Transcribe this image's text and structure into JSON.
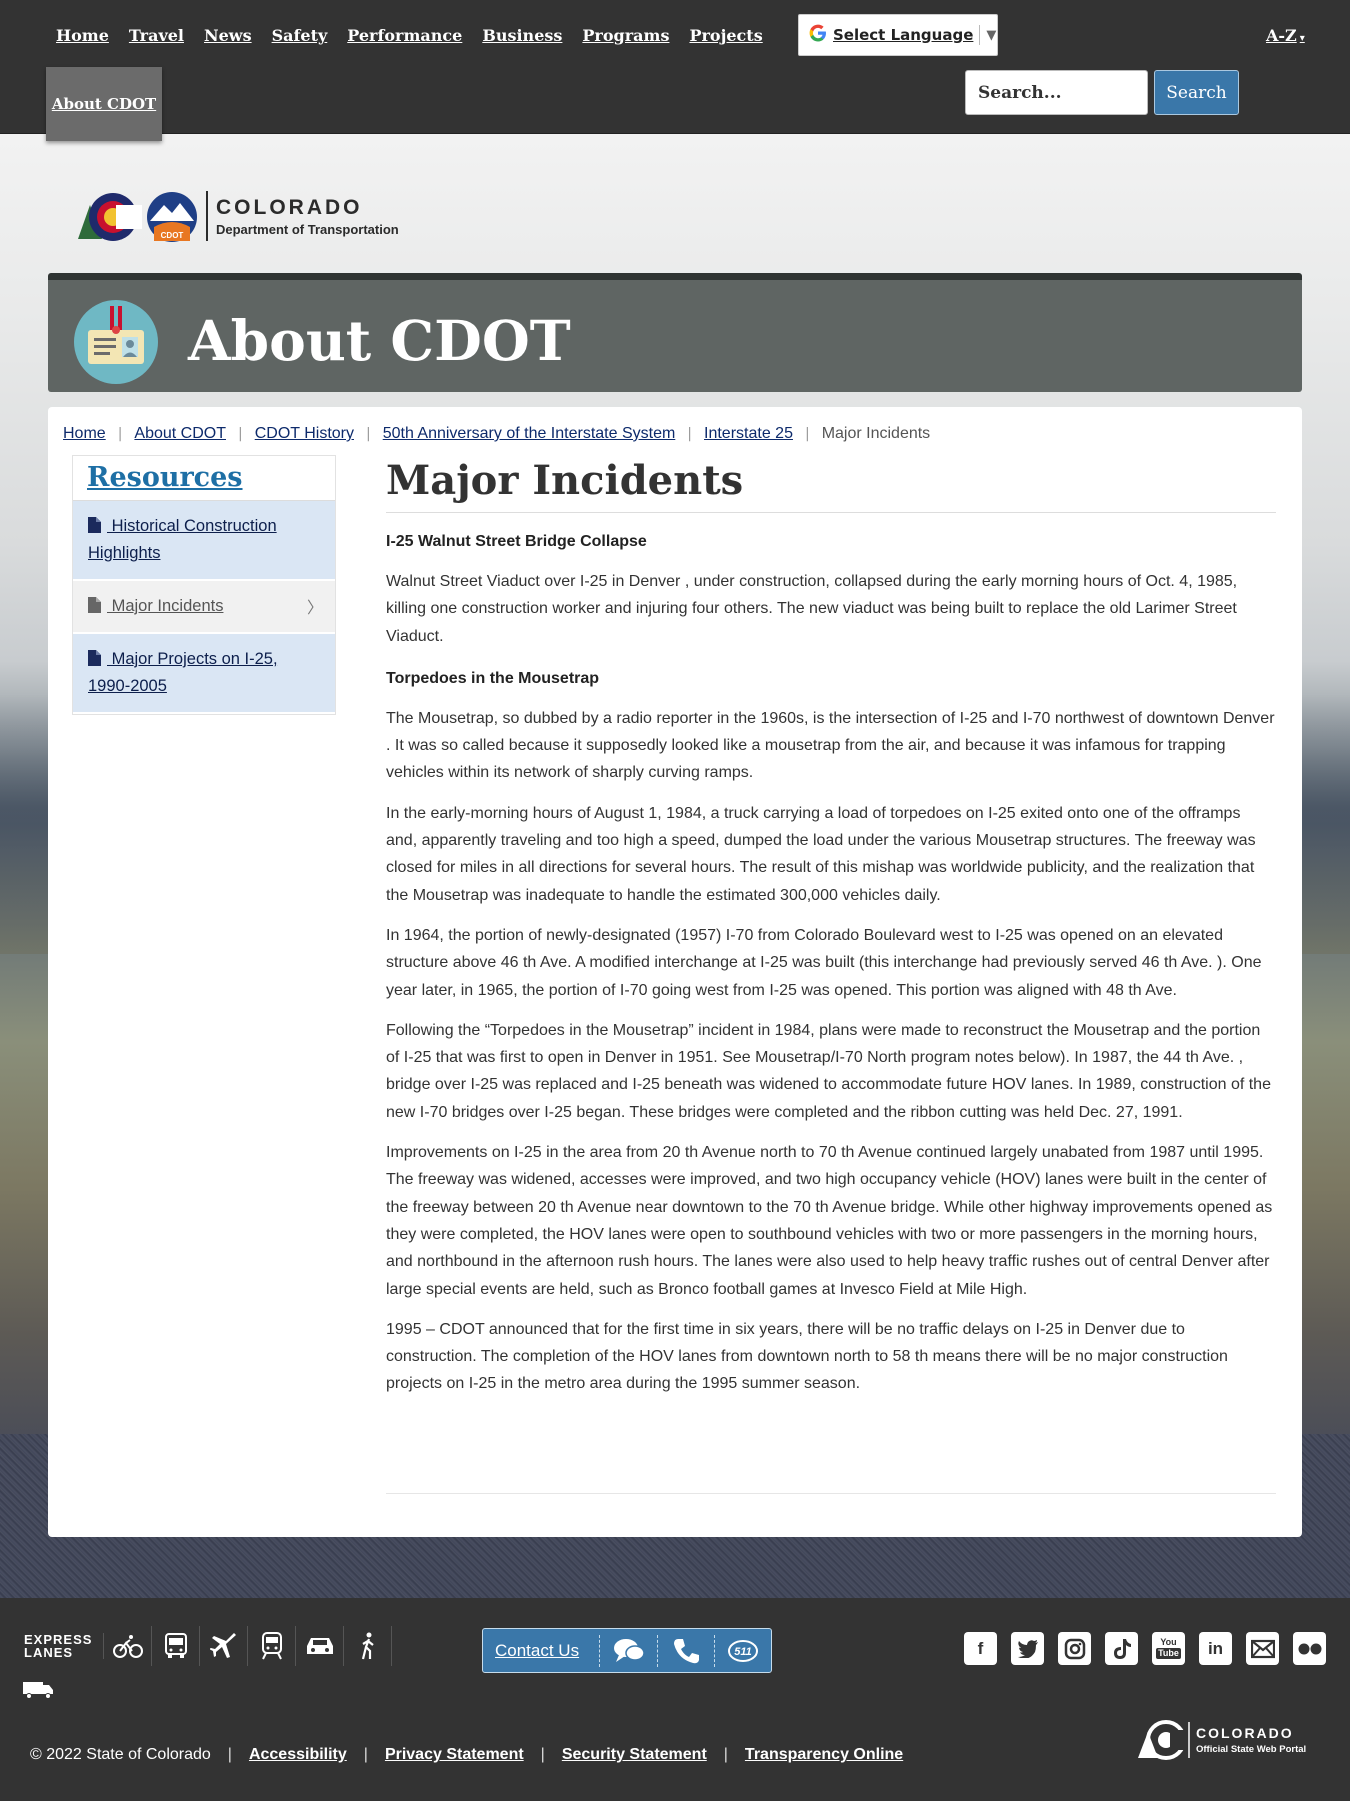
{
  "topnav": {
    "links": [
      "Home",
      "Travel",
      "News",
      "Safety",
      "Performance",
      "Business",
      "Programs",
      "Projects"
    ],
    "about": "About CDOT",
    "language": {
      "label": "Select Language",
      "google": "G",
      "arrow": "▼"
    },
    "az": "A-Z",
    "search": {
      "placeholder": "Search...",
      "button": "Search"
    }
  },
  "logo": {
    "name": "COLORADO",
    "subtitle": "Department of Transportation",
    "badge": "CDOT"
  },
  "banner": {
    "title": "About CDOT"
  },
  "breadcrumb": {
    "links": [
      "Home",
      "About CDOT",
      "CDOT History",
      "50th Anniversary of the Interstate System",
      "Interstate 25"
    ],
    "current": "Major Incidents"
  },
  "sidebar": {
    "title": "Resources",
    "items": [
      {
        "label": " Historical Construction Highlights",
        "active": false
      },
      {
        "label": " Major Incidents",
        "active": true
      },
      {
        "label": " Major Projects on I-25, 1990-2005",
        "active": false
      }
    ],
    "chevron": "〉"
  },
  "main": {
    "title": "Major Incidents",
    "heading1": "I-25 Walnut Street Bridge Collapse",
    "p1": "Walnut Street Viaduct over I-25 in Denver , under construction, collapsed during the early morning hours of Oct. 4, 1985, killing one construction worker and injuring four others. The new viaduct was being built to replace the old Larimer Street Viaduct.",
    "heading2": "Torpedoes in the Mousetrap",
    "p2": "The Mousetrap, so dubbed by a radio reporter in the 1960s, is the intersection of I-25 and I-70 northwest of downtown Denver . It was so called because it supposedly looked like a mousetrap from the air, and because it was infamous for trapping vehicles within its network of sharply curving ramps.",
    "p3": "In the early-morning hours of August 1, 1984, a truck carrying a load of torpedoes on I-25 exited onto one of the offramps and, apparently traveling and too high a speed, dumped the load under the various Mousetrap structures. The freeway was closed for miles in all directions for several hours. The result of this mishap was worldwide publicity, and the realization that the Mousetrap was inadequate to handle the estimated 300,000 vehicles daily.",
    "p4": "In 1964, the portion of newly-designated (1957) I-70 from Colorado Boulevard west to I-25 was opened on an elevated structure above 46 th Ave. A modified interchange at I-25 was built (this interchange had previously served 46 th Ave. ). One year later, in 1965, the portion of I-70 going west from I-25 was opened. This portion was aligned with 48 th Ave.",
    "p5": "Following the “Torpedoes in the Mousetrap” incident in 1984, plans were made to reconstruct the Mousetrap and the portion of I-25 that was first to open in Denver in 1951. See Mousetrap/I-70 North program notes below). In 1987, the 44 th Ave. , bridge over I-25 was replaced and I-25 beneath was widened to accommodate future HOV lanes. In 1989, construction of the new I-70 bridges over I-25 began. These bridges were completed and the ribbon cutting was held Dec. 27, 1991.",
    "p6": "Improvements on I-25 in the area from 20 th Avenue north to 70 th Avenue continued largely unabated from 1987 until 1995. The freeway was widened, accesses were improved, and two high occupancy vehicle (HOV) lanes were built in the center of the freeway between 20 th Avenue near downtown to the 70 th Avenue bridge. While other highway improvements opened as they were completed, the HOV lanes were open to southbound vehicles with two or more passengers in the morning hours, and northbound in the afternoon rush hours. The lanes were also used to help heavy traffic rushes out of central Denver after large special events are held, such as Bronco football games at Invesco Field at Mile High.",
    "p7": "1995 – CDOT announced that for the first time in six years, there will be no traffic delays on I-25 in Denver due to construction. The completion of the HOV lanes from downtown north to 58 th means there will be no major construction projects on I-25 in the metro area during the 1995 summer season."
  },
  "footer": {
    "express": [
      "EXPRESS",
      "LANES"
    ],
    "mode_icons": [
      "bike-icon",
      "bus-icon",
      "airplane-icon",
      "train-icon",
      "car-icon",
      "pedestrian-icon",
      "truck-icon"
    ],
    "contact": "Contact Us",
    "contact_511": "511",
    "social": [
      "f",
      "t",
      "ig",
      "tt",
      "You Tube",
      "in",
      "mail",
      "flickr"
    ],
    "copyright": "© 2022 State of Colorado",
    "links": [
      "Accessibility",
      "Privacy Statement",
      "Security Statement",
      "Transparency Online"
    ],
    "state_logo": {
      "name": "COLORADO",
      "subtitle": "Official State Web Portal"
    }
  },
  "colors": {
    "nav_bg": "#333333",
    "banner_bg": "#5f6563",
    "link": "#0d2a6b",
    "accent": "#3a77a9",
    "side_active": "#dae6f4"
  }
}
